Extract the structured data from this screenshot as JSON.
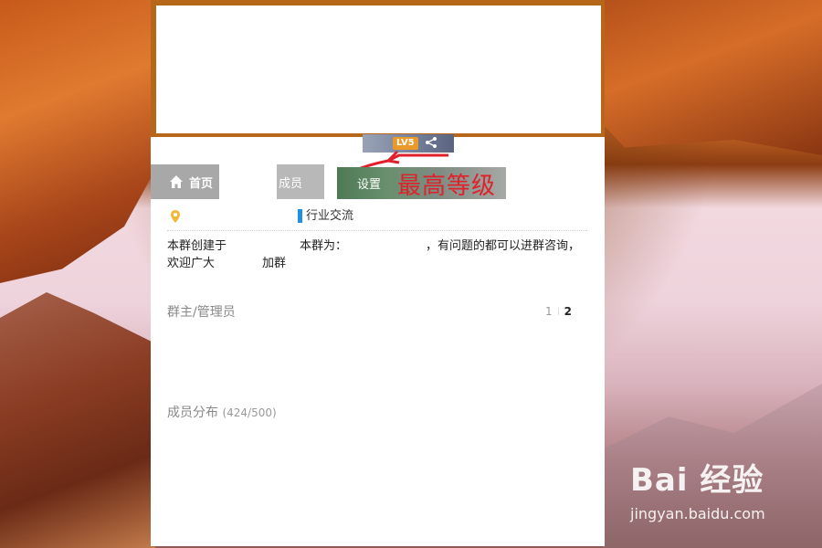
{
  "header": {
    "level_badge": "LV5",
    "share_icon": "share-icon"
  },
  "nav": {
    "home_label": "首页",
    "members_label": "成员",
    "settings_label": "设置"
  },
  "annotation": {
    "text": "最高等级",
    "color": "#e0202a"
  },
  "group": {
    "tag": "行业交流",
    "tag_color": "#1e90e8",
    "intro_line1": {
      "part1": "本群创建于",
      "part2": "本群为：",
      "part3": "，有问题的都可以进群咨询，"
    },
    "intro_line2": {
      "part1": "欢迎广大",
      "part2": "加群"
    }
  },
  "admins": {
    "title": "群主/管理员",
    "pages": [
      "1",
      "2"
    ],
    "current_page": "2"
  },
  "distribution": {
    "title": "成员分布",
    "count": "(424/500)"
  },
  "watermark": {
    "logo": "Bai 经验",
    "url": "jingyan.baidu.com"
  }
}
